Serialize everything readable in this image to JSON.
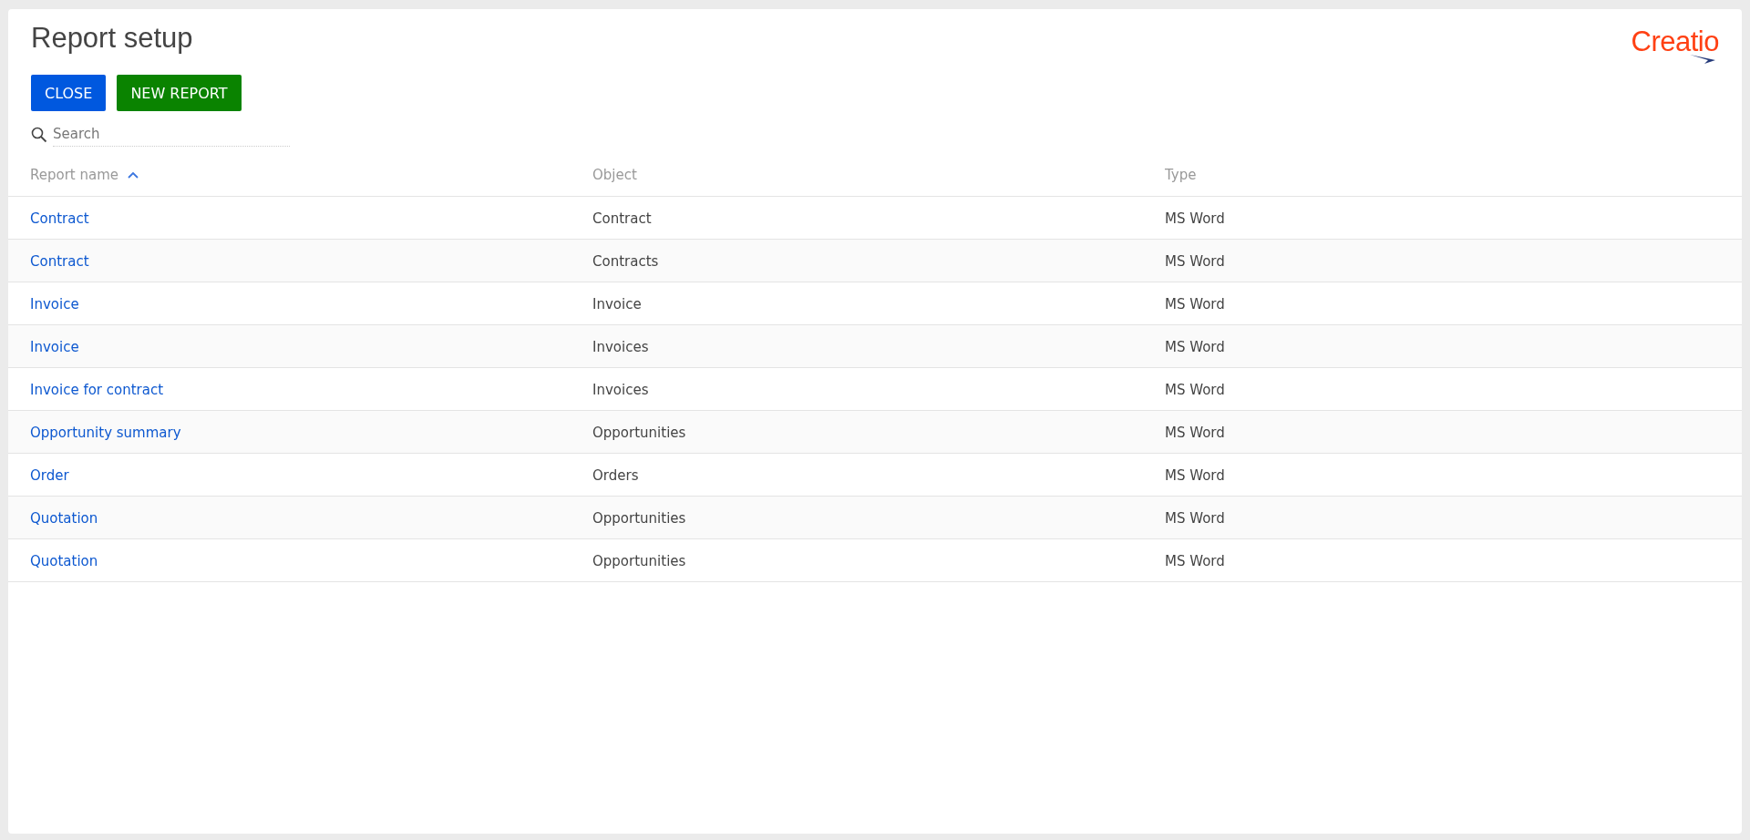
{
  "page": {
    "title": "Report setup",
    "logo": "Creatio"
  },
  "buttons": [
    {
      "label": "CLOSE",
      "kind": "primary"
    },
    {
      "label": "NEW REPORT",
      "kind": "success"
    }
  ],
  "search": {
    "placeholder": "Search"
  },
  "table": {
    "columns": [
      {
        "label": "Report name",
        "sorted": true
      },
      {
        "label": "Object",
        "sorted": false
      },
      {
        "label": "Type",
        "sorted": false
      }
    ],
    "rows": [
      [
        "Contract",
        "Contract",
        "MS Word"
      ],
      [
        "Contract",
        "Contracts",
        "MS Word"
      ],
      [
        "Invoice",
        "Invoice",
        "MS Word"
      ],
      [
        "Invoice",
        "Invoices",
        "MS Word"
      ],
      [
        "Invoice for contract",
        "Invoices",
        "MS Word"
      ],
      [
        "Opportunity summary",
        "Opportunities",
        "MS Word"
      ],
      [
        "Order",
        "Orders",
        "MS Word"
      ],
      [
        "Quotation",
        "Opportunities",
        "MS Word"
      ],
      [
        "Quotation",
        "Opportunities",
        "MS Word"
      ]
    ]
  }
}
